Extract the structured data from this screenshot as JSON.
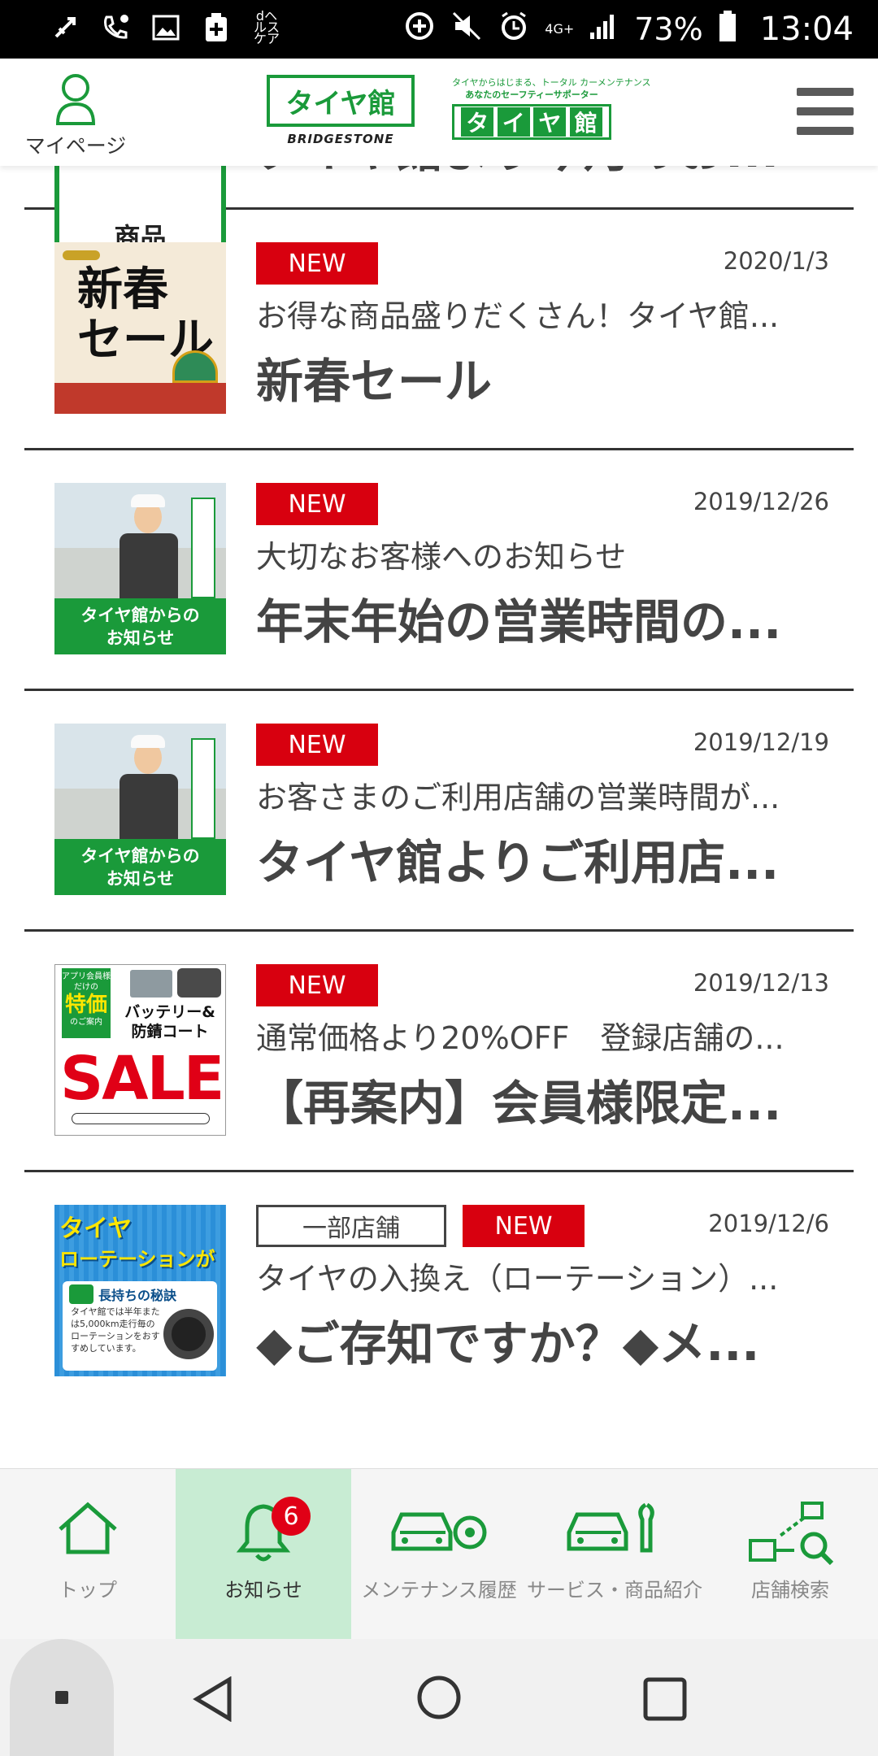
{
  "status_bar": {
    "battery_percent": "73%",
    "time": "13:04",
    "network": "4G+",
    "left_icons": [
      "usb-icon",
      "missed-call-icon",
      "image-icon",
      "medical-icon",
      "d-health-icon"
    ],
    "d_health_label": "dヘルスケア"
  },
  "header": {
    "mypage_label": "マイページ",
    "logo_main": "タイヤ館",
    "logo_brand": "BRIDGESTONE",
    "logo_sub_line1": "タイヤからはじまる、トータル カーメンテナンス",
    "logo_sub_line2": "あなたのセーフティーサポーター",
    "logo_chars": [
      "タ",
      "イ",
      "ヤ",
      "館"
    ]
  },
  "news": {
    "partial_item": {
      "thumb_label": "商品",
      "title": "タイヤ館より今月のお..."
    },
    "items": [
      {
        "badge_new": "NEW",
        "date": "2020/1/3",
        "subtitle": "お得な商品盛りだくさん！タイヤ館...",
        "title": "新春セール",
        "thumb_text_line1": "新春",
        "thumb_text_line2": "セール"
      },
      {
        "badge_new": "NEW",
        "date": "2019/12/26",
        "subtitle": "大切なお客様へのお知らせ",
        "title": "年末年始の営業時間の...",
        "thumb_line1": "タイヤ館からの",
        "thumb_line2": "お知らせ"
      },
      {
        "badge_new": "NEW",
        "date": "2019/12/19",
        "subtitle": "お客さまのご利用店舗の営業時間が...",
        "title": "タイヤ館よりご利用店...",
        "thumb_line1": "タイヤ館からの",
        "thumb_line2": "お知らせ"
      },
      {
        "badge_new": "NEW",
        "date": "2019/12/13",
        "subtitle": "通常価格より20%OFF　登録店舗の...",
        "title": "【再案内】会員様限定...",
        "thumb_side_small1": "アプリ会員様",
        "thumb_side_small2": "だけの",
        "thumb_side_big": "特価",
        "thumb_side_small3": "のご案内",
        "thumb_text": "バッテリー&防錆コート",
        "thumb_big": "SALE"
      },
      {
        "badge_store": "一部店舗",
        "badge_new": "NEW",
        "date": "2019/12/6",
        "subtitle": "タイヤの入換え（ローテーション）...",
        "title": "◆ご存知ですか？◆メ...",
        "thumb_line1": "タイヤ",
        "thumb_line2": "ローテーションが",
        "thumb_line3": "長持ちの秘訣",
        "thumb_note": "タイヤ館では半年または5,000km走行毎のローテーションをおすすめしています。"
      }
    ]
  },
  "bottom_nav": {
    "items": [
      {
        "label": "トップ",
        "icon": "home-icon",
        "active": false
      },
      {
        "label": "お知らせ",
        "icon": "bell-icon",
        "active": true,
        "badge": "6"
      },
      {
        "label": "メンテナンス履歴",
        "icon": "car-maintenance-icon",
        "active": false
      },
      {
        "label": "サービス・商品紹介",
        "icon": "car-wrench-icon",
        "active": false
      },
      {
        "label": "店舗検索",
        "icon": "store-search-icon",
        "active": false
      }
    ]
  },
  "colors": {
    "brand_green": "#1a9a3a",
    "new_red": "#d8000f",
    "active_tab_bg": "#c8ecd3"
  }
}
